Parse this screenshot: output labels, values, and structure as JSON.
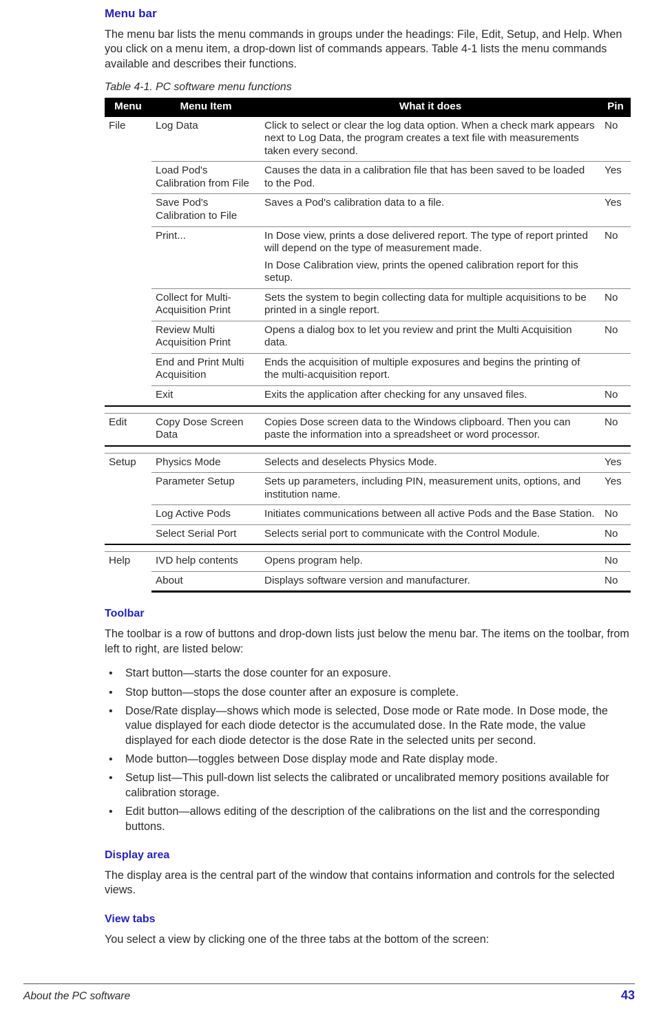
{
  "headings": {
    "menu_bar": "Menu bar",
    "toolbar": "Toolbar",
    "display_area": "Display area",
    "view_tabs": "View tabs"
  },
  "paragraphs": {
    "menu_bar_intro": "The menu bar lists the menu commands in groups under the headings: File, Edit, Setup, and Help. When you click on a menu item, a drop-down list of commands appears. Table 4-1 lists the menu commands available and describes their functions.",
    "table_caption": "Table 4-1. PC software menu functions",
    "toolbar_intro": "The toolbar is a row of buttons and drop-down lists just below the menu bar. The items on the toolbar, from left to right, are listed below:",
    "display_area_intro": "The display area is the central part of the window that contains information and controls for the selected views.",
    "view_tabs_intro": "You select a view by clicking one of the three tabs at the bottom of the screen:"
  },
  "table": {
    "headers": {
      "menu": "Menu",
      "item": "Menu Item",
      "desc": "What it does",
      "pin": "Pin"
    },
    "groups": [
      {
        "menu": "File",
        "rows": [
          {
            "item": "Log Data",
            "desc": [
              "Click to select or clear the log data option. When a check mark appears next to Log Data, the program creates a text file with measurements taken every second."
            ],
            "pin": "No"
          },
          {
            "item": "Load Pod's Calibration from File",
            "desc": [
              "Causes the data in a calibration file that has been saved to be loaded to the Pod."
            ],
            "pin": "Yes"
          },
          {
            "item": "Save Pod's Calibration to File",
            "desc": [
              "Saves a Pod's calibration data to a file."
            ],
            "pin": "Yes"
          },
          {
            "item": "Print...",
            "desc": [
              "In Dose view, prints a dose delivered report. The type of report printed will depend on the type of measurement made.",
              "In Dose Calibration view, prints the opened calibration report for this setup."
            ],
            "pin": "No"
          },
          {
            "item": "Collect for Multi-Acquisition Print",
            "desc": [
              "Sets the system to begin collecting data for multiple acquisitions to be printed in a single report."
            ],
            "pin": "No"
          },
          {
            "item": "Review Multi Acquisition Print",
            "desc": [
              "Opens a dialog box to let you review and print the Multi Acquisition data."
            ],
            "pin": "No"
          },
          {
            "item": "End and Print Multi Acquisition",
            "desc": [
              "Ends the acquisition of multiple exposures and begins the printing of the multi-acquisition report."
            ],
            "pin": ""
          },
          {
            "item": "Exit",
            "desc": [
              "Exits the application after checking for any unsaved files."
            ],
            "pin": "No"
          }
        ]
      },
      {
        "menu": "Edit",
        "rows": [
          {
            "item": "Copy Dose Screen Data",
            "desc": [
              "Copies Dose screen data to the Windows clipboard. Then you can paste the information into a spreadsheet or word processor."
            ],
            "pin": "No"
          }
        ]
      },
      {
        "menu": "Setup",
        "rows": [
          {
            "item": "Physics Mode",
            "desc": [
              "Selects and deselects Physics Mode."
            ],
            "pin": "Yes"
          },
          {
            "item": "Parameter Setup",
            "desc": [
              "Sets up parameters, including PIN, measurement units, options, and institution name."
            ],
            "pin": "Yes"
          },
          {
            "item": "Log Active Pods",
            "desc": [
              "Initiates communications between all active Pods and the Base Station."
            ],
            "pin": "No"
          },
          {
            "item": "Select Serial Port",
            "desc": [
              "Selects serial port to communicate with the Control Module."
            ],
            "pin": "No"
          }
        ]
      },
      {
        "menu": "Help",
        "rows": [
          {
            "item": "IVD help contents",
            "desc": [
              "Opens program help."
            ],
            "pin": "No"
          },
          {
            "item": "About",
            "desc": [
              "Displays software version and manufacturer."
            ],
            "pin": "No"
          }
        ]
      }
    ]
  },
  "toolbar_bullets": [
    "Start button—starts the dose counter for an exposure.",
    "Stop button—stops the dose counter after an exposure is complete.",
    "Dose/Rate display—shows which mode is selected, Dose mode or Rate mode. In Dose mode, the value displayed for each diode detector is the accumulated dose. In the Rate mode, the value displayed for each diode detector is the dose Rate in the selected units per second.",
    "Mode button—toggles between Dose display mode and Rate display mode.",
    "Setup list—This pull-down list selects the calibrated or uncalibrated memory positions available for calibration storage.",
    "Edit button—allows editing of the description of the calibrations on the list and the corresponding buttons."
  ],
  "footer": {
    "title": "About the PC software",
    "page": "43"
  }
}
